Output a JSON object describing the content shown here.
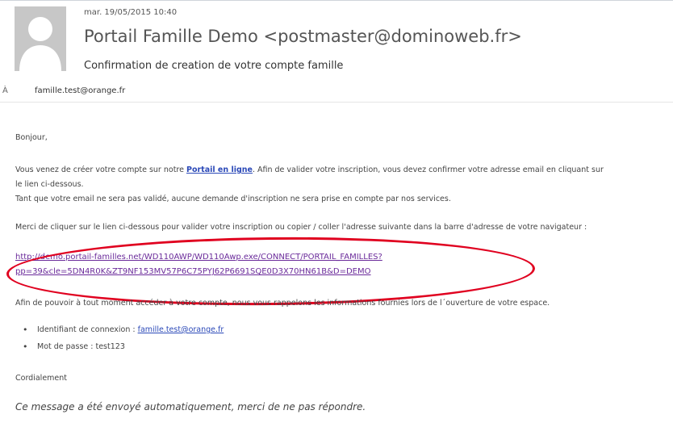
{
  "header": {
    "date": "mar. 19/05/2015 10:40",
    "from": "Portail Famille Demo <postmaster@dominoweb.fr>",
    "subject": "Confirmation de creation de votre compte famille",
    "to_label": "À",
    "to_value": "famille.test@orange.fr"
  },
  "body": {
    "greeting": "Bonjour,",
    "p1_before": "Vous venez de créer votre compte sur notre ",
    "p1_link": "Portail en ligne",
    "p1_after": ". Afin de valider votre inscription, vous devez confirmer votre adresse email en cliquant sur",
    "p1_line2": "le lien ci-dessous.",
    "p2": "Tant que votre email ne sera pas validé, aucune demande d'inscription ne sera prise en compte par nos services.",
    "p3": "Merci de cliquer sur le lien ci-dessous pour valider votre inscription ou copier / coller l'adresse suivante dans la barre d'adresse de votre navigateur :",
    "link_line1": "http://demo.portail-familles.net/WD110AWP/WD110Awp.exe/CONNECT/PORTAIL_FAMILLES?",
    "link_line2": "pp=39&cle=5DN4R0K&ZT9NF153MV57P6C75PYJ62P6691SQE0D3X70HN61B&D=DEMO",
    "p4": "Afin de pouvoir à tout moment accéder à votre compte, nous vous rappelons les informations fournies lors de l´ouverture de votre espace.",
    "id_label": "Identifiant de connexion : ",
    "id_value": "famille.test@orange.fr",
    "pwd_label": "Mot de passe : ",
    "pwd_value": "test123",
    "closing": "Cordialement",
    "footer": "Ce message a été envoyé automatiquement, merci de ne pas répondre."
  },
  "colors": {
    "link": "#2b49b8",
    "visited_link": "#6a2a9a",
    "highlight_ellipse": "#e0001f",
    "avatar_bg": "#c7c7c7"
  },
  "icons": {
    "avatar": "person-silhouette-icon"
  }
}
